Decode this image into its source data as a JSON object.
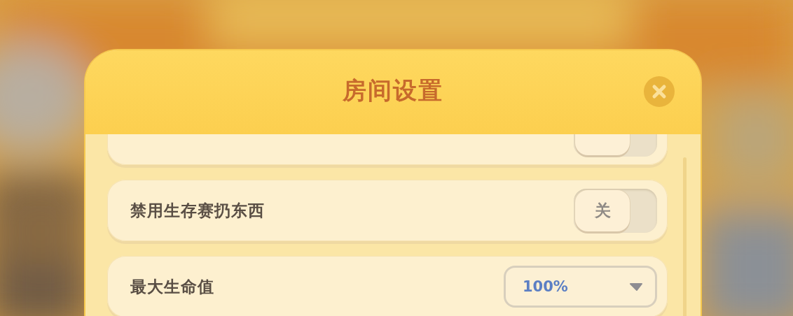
{
  "dialog": {
    "title": "房间设置"
  },
  "settings": [
    {
      "kind": "toggle",
      "on": false
    },
    {
      "kind": "toggle",
      "label": "禁用生存赛扔东西",
      "on": false,
      "state_text": "关"
    },
    {
      "kind": "dropdown",
      "label": "最大生命值",
      "value": "100%"
    }
  ]
}
